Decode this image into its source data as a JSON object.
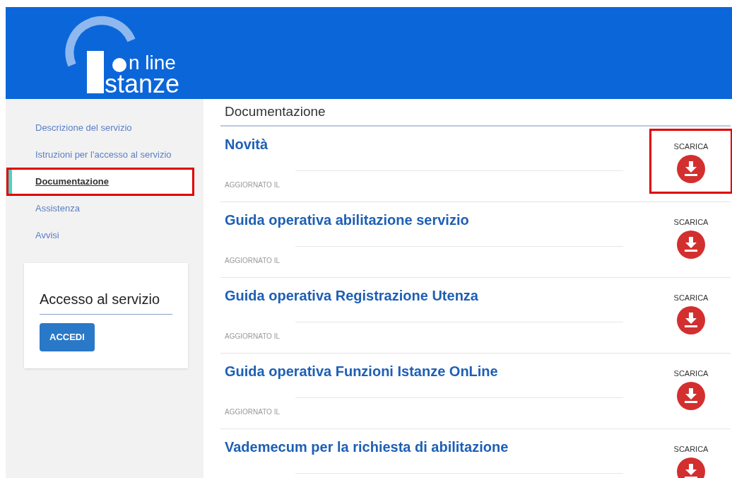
{
  "logo": {
    "line1": "n line",
    "line2": "stanze"
  },
  "sidebar": {
    "items": [
      {
        "label": "Descrizione del servizio",
        "selected": false,
        "highlighted": false
      },
      {
        "label": "Istruzioni per l'accesso al servizio",
        "selected": false,
        "highlighted": false
      },
      {
        "label": "Documentazione",
        "selected": true,
        "highlighted": true
      },
      {
        "label": "Assistenza",
        "selected": false,
        "highlighted": false
      },
      {
        "label": "Avvisi",
        "selected": false,
        "highlighted": false
      }
    ],
    "access_card": {
      "title": "Accesso al servizio",
      "button": "ACCEDI"
    }
  },
  "main": {
    "heading": "Documentazione",
    "documents": [
      {
        "title": "Novità",
        "updated": "AGGIORNATO IL",
        "download": "SCARICA",
        "highlighted": true
      },
      {
        "title": "Guida operativa abilitazione servizio",
        "updated": "AGGIORNATO IL",
        "download": "SCARICA",
        "highlighted": false
      },
      {
        "title": "Guida operativa Registrazione Utenza",
        "updated": "AGGIORNATO IL",
        "download": "SCARICA",
        "highlighted": false
      },
      {
        "title": "Guida operativa Funzioni Istanze OnLine",
        "updated": "AGGIORNATO IL",
        "download": "SCARICA",
        "highlighted": false
      },
      {
        "title": "Vademecum per la richiesta di abilitazione",
        "download": "SCARICA",
        "highlighted": false
      }
    ]
  }
}
